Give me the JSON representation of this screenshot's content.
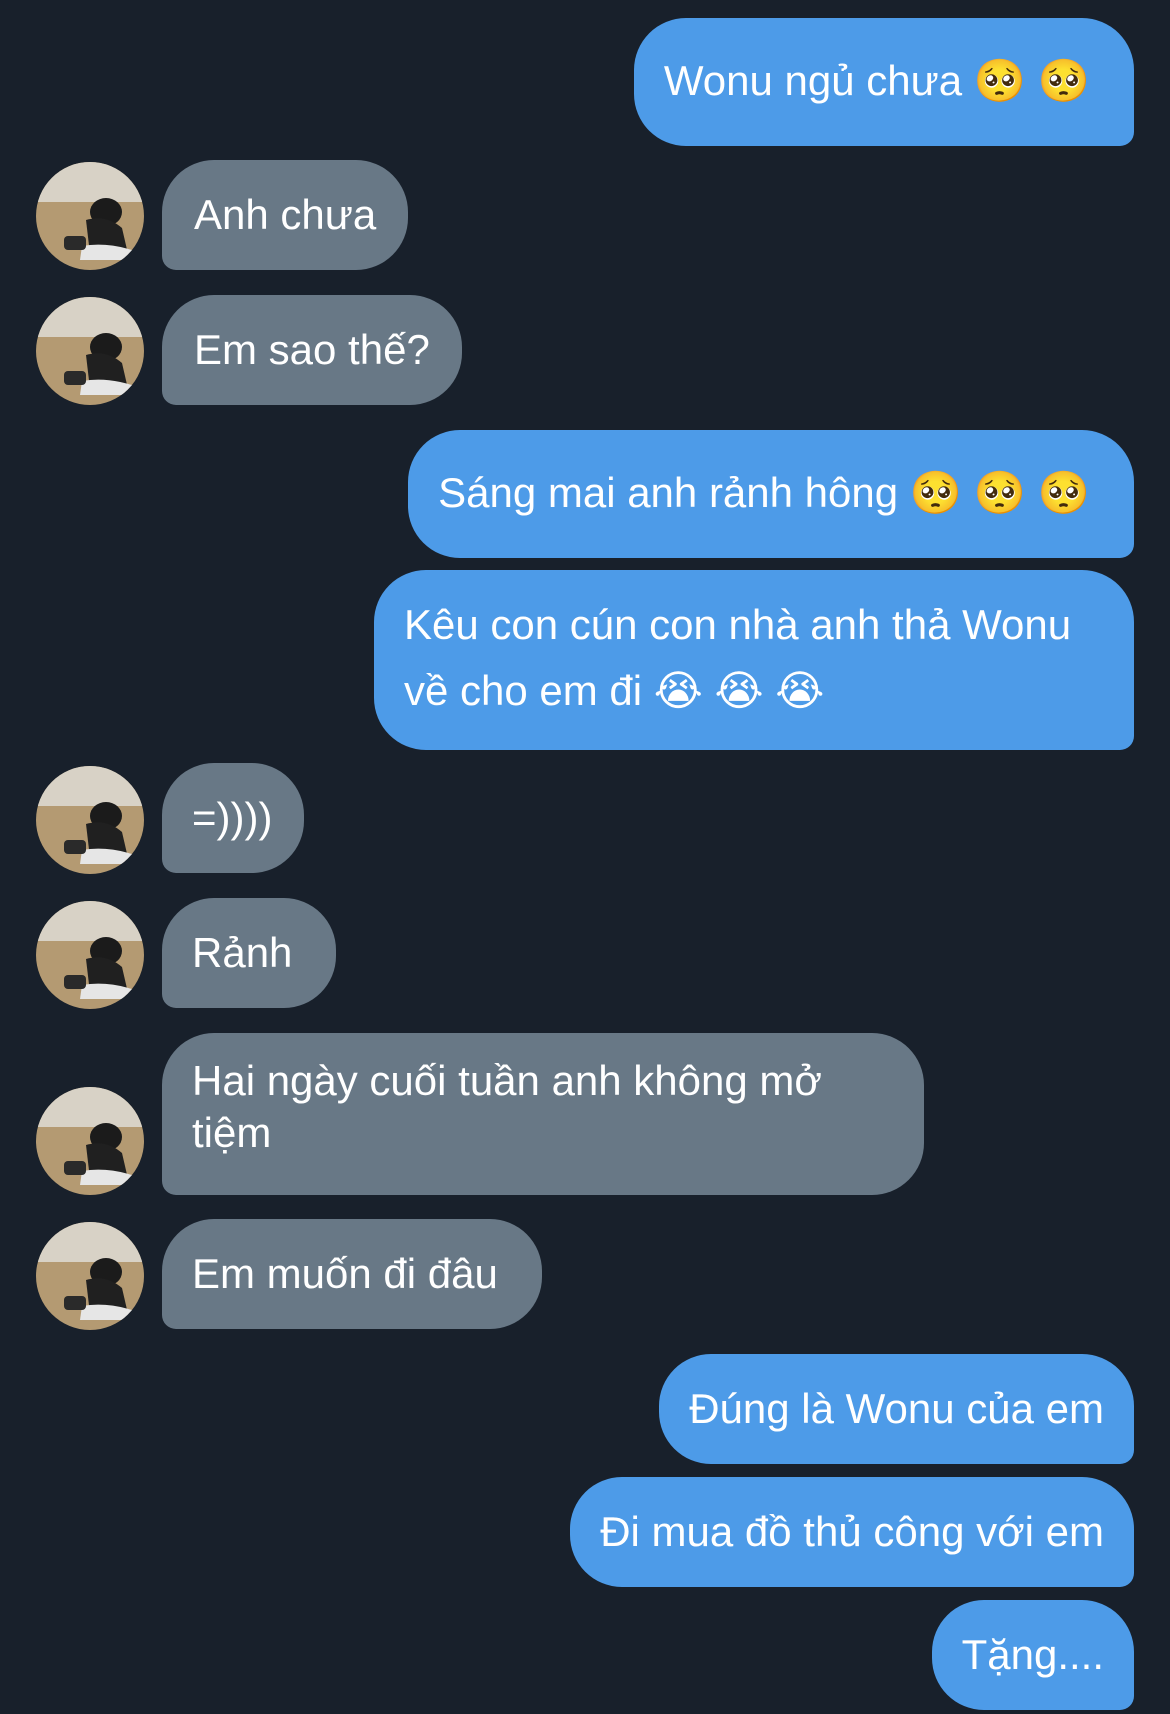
{
  "conversation": {
    "messages": [
      {
        "id": "m1",
        "side": "out",
        "text": "Wonu ngủ chưa 🥺 🥺"
      },
      {
        "id": "m2",
        "side": "in",
        "text": "Anh chưa"
      },
      {
        "id": "m3",
        "side": "in",
        "text": "Em sao thế?"
      },
      {
        "id": "m4",
        "side": "out",
        "text": "Sáng mai anh rảnh hông 🥺 🥺 🥺"
      },
      {
        "id": "m5",
        "side": "out",
        "text": "Kêu con cún con nhà anh thả Wonu về cho em đi 😭 😭 😭"
      },
      {
        "id": "m6",
        "side": "in",
        "text": "=))))"
      },
      {
        "id": "m7",
        "side": "in",
        "text": "Rảnh"
      },
      {
        "id": "m8",
        "side": "in",
        "text": "Hai ngày cuối tuần anh không mở tiệm"
      },
      {
        "id": "m9",
        "side": "in",
        "text": "Em muốn đi đâu"
      },
      {
        "id": "m10",
        "side": "out",
        "text": "Đúng là Wonu của em"
      },
      {
        "id": "m11",
        "side": "out",
        "text": "Đi mua đồ thủ công với em"
      },
      {
        "id": "m12",
        "side": "out",
        "text": "Tặng...."
      }
    ]
  },
  "colors": {
    "background": "#18202b",
    "outgoing_bubble": "#4d9be8",
    "incoming_bubble": "#687886",
    "text": "#ffffff"
  },
  "icons": {
    "contact_avatar": "contact-avatar-photo"
  }
}
